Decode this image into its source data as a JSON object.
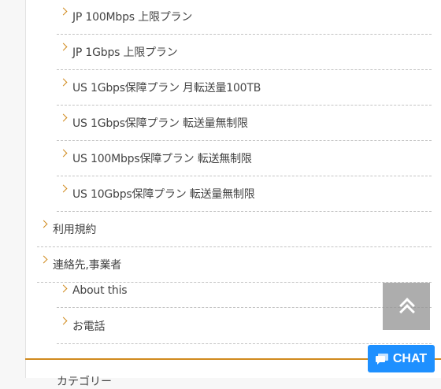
{
  "menu": {
    "items": [
      {
        "label": "JP 100Mbps 上限プラン"
      },
      {
        "label": "JP 1Gbps 上限プラン"
      },
      {
        "label": "US 1Gbps保障プラン 月転送量100TB"
      },
      {
        "label": "US 1Gbps保障プラン 転送量無制限"
      },
      {
        "label": "US 100Mbps保障プラン 転送無制限"
      },
      {
        "label": "US 10Gbps保障プラン 転送量無制限"
      },
      {
        "label": "利用規約"
      },
      {
        "label": "連絡先,事業者"
      },
      {
        "label": "About this"
      },
      {
        "label": "お電話"
      }
    ]
  },
  "next_section": {
    "heading": "カテゴリー"
  },
  "chat": {
    "label": "CHAT"
  },
  "colors": {
    "accent": "#d08a1d",
    "chat_bg": "#1e90ff",
    "scroll_top_bg": "#969696"
  },
  "icons": {
    "item": "chevron-right-icon",
    "scroll_top": "double-chevron-up-icon",
    "chat": "chat-bubble-icon"
  }
}
